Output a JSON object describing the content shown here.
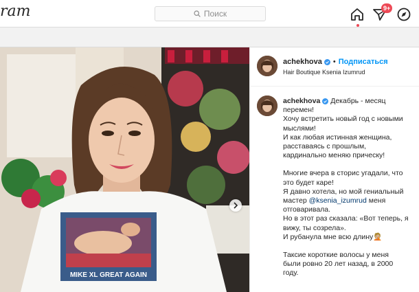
{
  "topbar": {
    "logo_fragment": "ram",
    "search_placeholder": "Поиск",
    "notifications_badge": "9+"
  },
  "post": {
    "author": {
      "username": "achekhova",
      "verified": true,
      "follow_label": "Подписаться",
      "location": "Hair Boutique Ksenia Izumrud"
    },
    "caption": {
      "username": "achekhova",
      "first_line": "Декабрь - месяц",
      "lines": [
        "перемен!",
        "Хочу встретить новый год с новыми",
        "мыслями!",
        "И как любая истинная женщина,",
        "расставаясь с прошлым,",
        "кардинально меняю прическу!"
      ],
      "para2": [
        "Многие вчера в сторис угадали, что",
        "это будет каре!",
        "Я давно хотела, но мой гениальный"
      ],
      "mention_prefix": "мастер ",
      "mention": "@ksenia_izumrud",
      "mention_suffix": " меня",
      "para2_rest": [
        "отговаривала.",
        "Но в этот раз сказала: «Вот теперь, я",
        "вижу, ты созрела».",
        "И рубанула мне всю длину🤦🏼"
      ],
      "para3": [
        "Таксие короткие волосы у меня",
        "были ровно 20 лет назад, в 2000",
        "году."
      ]
    },
    "photo": {
      "shirt_text": "MIKE XL GREAT AGAIN"
    }
  },
  "colors": {
    "accent": "#0095f6",
    "badge": "#ed4956",
    "border": "#dbdbdb"
  }
}
